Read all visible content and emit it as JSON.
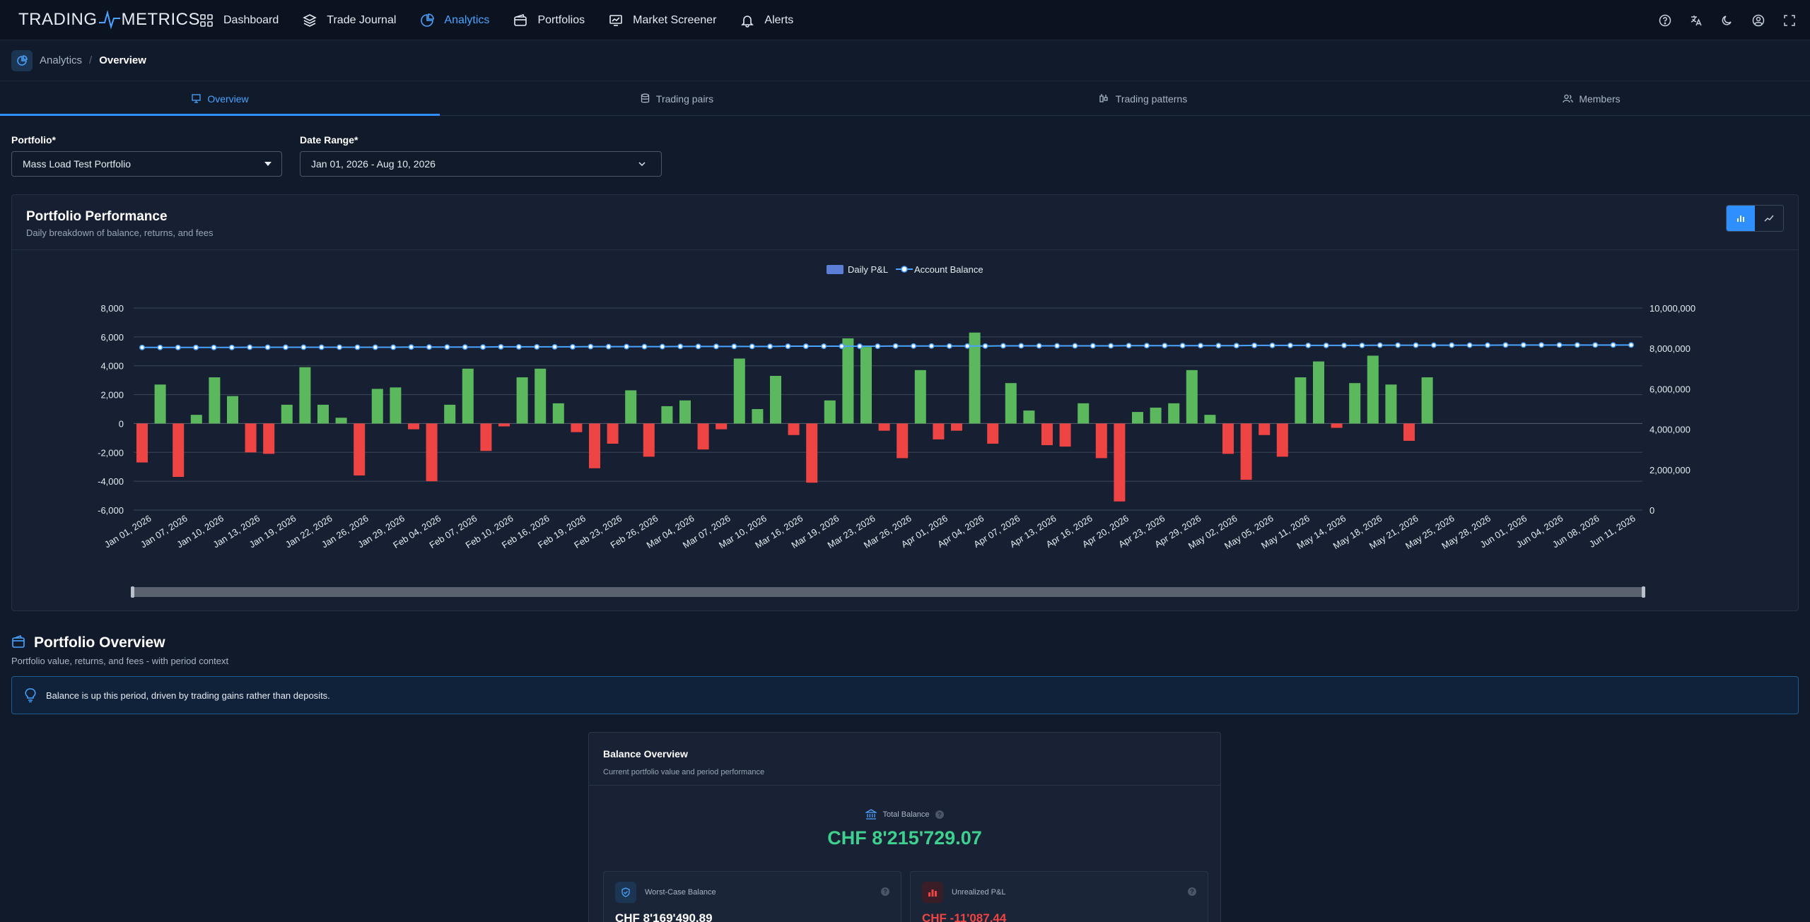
{
  "brand": {
    "left": "TRADING",
    "right": "METRICS"
  },
  "nav": {
    "items": [
      {
        "label": "Dashboard",
        "icon": "grid-icon",
        "active": false
      },
      {
        "label": "Trade Journal",
        "icon": "layers-icon",
        "active": false
      },
      {
        "label": "Analytics",
        "icon": "pie-chart-icon",
        "active": true
      },
      {
        "label": "Portfolios",
        "icon": "wallet-icon",
        "active": false
      },
      {
        "label": "Market Screener",
        "icon": "monitor-chart-icon",
        "active": false
      },
      {
        "label": "Alerts",
        "icon": "bell-icon",
        "active": false
      }
    ],
    "right_icons": [
      "help-icon",
      "translate-icon",
      "moon-icon",
      "account-icon",
      "fullscreen-icon"
    ]
  },
  "breadcrumb": {
    "section": "Analytics",
    "separator": "/",
    "page": "Overview"
  },
  "tabs": [
    {
      "label": "Overview",
      "active": true
    },
    {
      "label": "Trading pairs",
      "active": false
    },
    {
      "label": "Trading patterns",
      "active": false
    },
    {
      "label": "Members",
      "active": false
    }
  ],
  "filters": {
    "portfolio_label": "Portfolio*",
    "portfolio_value": "Mass Load Test Portfolio",
    "date_label": "Date Range*",
    "date_value": "Jan 01, 2026 - Aug 10, 2026"
  },
  "performance": {
    "title": "Portfolio Performance",
    "subtitle": "Daily breakdown of balance, returns, and fees"
  },
  "chart_data": {
    "type": "bar",
    "legend": [
      "Daily P&L",
      "Account Balance"
    ],
    "legend_position": "top-center",
    "grid": true,
    "y_left_ticks": [
      "8,000",
      "6,000",
      "4,000",
      "2,000",
      "0",
      "-2,000",
      "-4,000",
      "-6,000"
    ],
    "y_right_ticks": [
      "10,000,000",
      "8,000,000",
      "6,000,000",
      "4,000,000",
      "2,000,000",
      "0"
    ],
    "ylim_left": [
      -6000,
      8000
    ],
    "ylim_right": [
      0,
      10000000
    ],
    "x_tick_labels": [
      "Jan 01, 2026",
      "Jan 07, 2026",
      "Jan 10, 2026",
      "Jan 13, 2026",
      "Jan 19, 2026",
      "Jan 22, 2026",
      "Jan 26, 2026",
      "Jan 29, 2026",
      "Feb 04, 2026",
      "Feb 07, 2026",
      "Feb 10, 2026",
      "Feb 16, 2026",
      "Feb 19, 2026",
      "Feb 23, 2026",
      "Feb 26, 2026",
      "Mar 04, 2026",
      "Mar 07, 2026",
      "Mar 10, 2026",
      "Mar 16, 2026",
      "Mar 19, 2026",
      "Mar 23, 2026",
      "Mar 26, 2026",
      "Apr 01, 2026",
      "Apr 04, 2026",
      "Apr 07, 2026",
      "Apr 13, 2026",
      "Apr 16, 2026",
      "Apr 20, 2026",
      "Apr 23, 2026",
      "Apr 29, 2026",
      "May 02, 2026",
      "May 05, 2026",
      "May 11, 2026",
      "May 14, 2026",
      "May 18, 2026",
      "May 21, 2026",
      "May 25, 2026",
      "May 28, 2026",
      "Jun 01, 2026",
      "Jun 04, 2026",
      "Jun 08, 2026",
      "Jun 11, 2026"
    ],
    "series": [
      {
        "name": "Daily P&L",
        "axis": "left",
        "values": [
          -2700,
          2700,
          -3700,
          600,
          3200,
          1900,
          -2000,
          -2100,
          1300,
          3900,
          1300,
          400,
          -3600,
          2400,
          2500,
          -400,
          -4000,
          1300,
          3800,
          -1900,
          -200,
          3200,
          3800,
          1400,
          -600,
          -3100,
          -1400,
          2300,
          -2300,
          1200,
          1600,
          -1800,
          -400,
          4500,
          1000,
          3300,
          -800,
          -4100,
          1600,
          5900,
          5300,
          -500,
          -2400,
          3700,
          -1100,
          -500,
          6300,
          -1400,
          2800,
          900,
          -1500,
          -1600,
          1400,
          -2400,
          -5400,
          800,
          1100,
          1400,
          3700,
          600,
          -2100,
          -3900,
          -800,
          -2300,
          3200,
          4300,
          -300,
          2800,
          4700,
          2700,
          -1200,
          3200
        ]
      },
      {
        "name": "Account Balance",
        "axis": "right",
        "values": [
          8050000,
          8050000,
          8050000,
          8050000,
          8050000,
          8050000,
          8060000,
          8060000,
          8060000,
          8060000,
          8060000,
          8060000,
          8060000,
          8060000,
          8060000,
          8070000,
          8070000,
          8070000,
          8070000,
          8070000,
          8080000,
          8080000,
          8080000,
          8080000,
          8080000,
          8090000,
          8090000,
          8090000,
          8090000,
          8090000,
          8100000,
          8100000,
          8100000,
          8100000,
          8100000,
          8100000,
          8110000,
          8110000,
          8110000,
          8110000,
          8110000,
          8110000,
          8120000,
          8120000,
          8120000,
          8120000,
          8120000,
          8120000,
          8130000,
          8130000,
          8130000,
          8130000,
          8130000,
          8130000,
          8130000,
          8140000,
          8140000,
          8140000,
          8140000,
          8140000,
          8140000,
          8140000,
          8150000,
          8150000,
          8150000,
          8150000,
          8150000,
          8150000,
          8150000,
          8160000,
          8160000,
          8160000,
          8160000,
          8160000,
          8160000,
          8160000,
          8170000,
          8170000,
          8170000,
          8170000,
          8170000,
          8170000,
          8170000,
          8170000
        ]
      }
    ],
    "colors": {
      "positive": "#5cb85c",
      "negative": "#ef4444",
      "balance": "#4aa3ff"
    }
  },
  "overview": {
    "title": "Portfolio Overview",
    "subtitle": "Portfolio value, returns, and fees - with period context",
    "insight": "Balance is up this period, driven by trading gains rather than deposits."
  },
  "balance": {
    "title": "Balance Overview",
    "subtitle": "Current portfolio value and period performance",
    "total_label": "Total Balance",
    "total_value": "CHF 8'215'729.07",
    "worst_label": "Worst-Case Balance",
    "worst_value": "CHF 8'169'490.89",
    "unrealized_label": "Unrealized P&L",
    "unrealized_value": "CHF -11'087.44"
  },
  "colors": {
    "accent": "#2f8fff",
    "positive": "#3fcf8e",
    "negative": "#ef4444"
  }
}
